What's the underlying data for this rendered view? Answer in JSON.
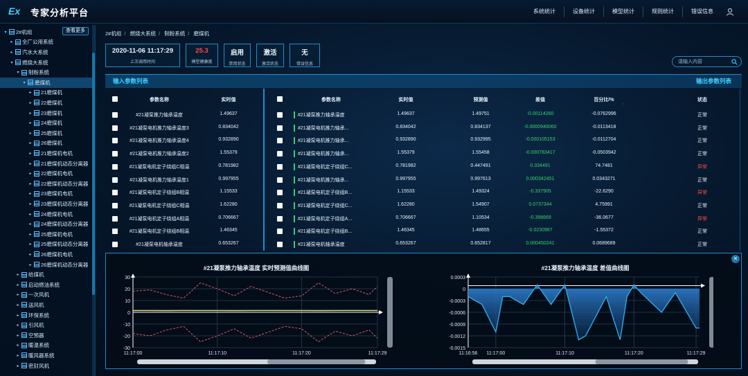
{
  "header": {
    "logo": "Ex",
    "title": "专家分析平台",
    "nav": [
      "系统统计",
      "设备统计",
      "模型统计",
      "规则统计",
      "错误信息"
    ],
    "colors": {
      "accent": "#3fd0ff",
      "panel_border": "#1c8fcf",
      "ok_green": "#35d36d",
      "alarm_red": "#ff4b4b"
    }
  },
  "sidebar": {
    "more_label": "查看更多",
    "tree": [
      {
        "label": "2#机组",
        "caret": "▾",
        "indent": 0
      },
      {
        "label": "全厂公用系统",
        "caret": "▸",
        "indent": 1
      },
      {
        "label": "汽水大系统",
        "caret": "▸",
        "indent": 1
      },
      {
        "label": "燃烧大系统",
        "caret": "▾",
        "indent": 1
      },
      {
        "label": "制粉系统",
        "caret": "▾",
        "indent": 2
      },
      {
        "label": "磨煤机",
        "caret": "▾",
        "indent": 3,
        "selected": true
      },
      {
        "label": "21磨煤机",
        "caret": "▸",
        "indent": 4
      },
      {
        "label": "22磨煤机",
        "caret": "▸",
        "indent": 4
      },
      {
        "label": "23磨煤机",
        "caret": "▸",
        "indent": 4
      },
      {
        "label": "24磨煤机",
        "caret": "▸",
        "indent": 4
      },
      {
        "label": "25磨煤机",
        "caret": "▸",
        "indent": 4
      },
      {
        "label": "26磨煤机",
        "caret": "▸",
        "indent": 4
      },
      {
        "label": "21磨煤机电机",
        "caret": "▸",
        "indent": 4
      },
      {
        "label": "21磨煤机动态分离器",
        "caret": "▸",
        "indent": 4
      },
      {
        "label": "22磨煤机电机",
        "caret": "▸",
        "indent": 4
      },
      {
        "label": "22磨煤机动态分离器",
        "caret": "▸",
        "indent": 4
      },
      {
        "label": "23磨煤机电机",
        "caret": "▸",
        "indent": 4
      },
      {
        "label": "23磨煤机动态分离器",
        "caret": "▸",
        "indent": 4
      },
      {
        "label": "24磨煤机电机",
        "caret": "▸",
        "indent": 4
      },
      {
        "label": "24磨煤机动态分离器",
        "caret": "▸",
        "indent": 4
      },
      {
        "label": "25磨煤机电机",
        "caret": "▸",
        "indent": 4
      },
      {
        "label": "25磨煤机动态分离器",
        "caret": "▸",
        "indent": 4
      },
      {
        "label": "26磨煤机电机",
        "caret": "▸",
        "indent": 4
      },
      {
        "label": "26磨煤机动态分离器",
        "caret": "▸",
        "indent": 4
      },
      {
        "label": "给煤机",
        "caret": "▸",
        "indent": 2
      },
      {
        "label": "启动燃油系统",
        "caret": "▸",
        "indent": 2
      },
      {
        "label": "一次风机",
        "caret": "▸",
        "indent": 2
      },
      {
        "label": "送风机",
        "caret": "▸",
        "indent": 2
      },
      {
        "label": "环保系统",
        "caret": "▸",
        "indent": 2
      },
      {
        "label": "引风机",
        "caret": "▸",
        "indent": 2
      },
      {
        "label": "空预器",
        "caret": "▸",
        "indent": 2
      },
      {
        "label": "暖温系统",
        "caret": "▸",
        "indent": 2
      },
      {
        "label": "暖风器系统",
        "caret": "▸",
        "indent": 2
      },
      {
        "label": "密封风机",
        "caret": "▸",
        "indent": 2
      }
    ]
  },
  "breadcrumb": [
    "2#机组",
    "燃烧大系统",
    "制粉系统",
    "磨煤机"
  ],
  "stats": [
    {
      "value": "2020-11-06 11:17:29",
      "label": "上次调用时间"
    },
    {
      "value": "25.3",
      "label": "模型健康度",
      "red": true
    },
    {
      "value": "启用",
      "label": "禁用状态"
    },
    {
      "value": "激活",
      "label": "激活状态"
    },
    {
      "value": "无",
      "label": "错误信息"
    }
  ],
  "search": {
    "placeholder": "请输入内容"
  },
  "input_panel": {
    "title": "输入参数列表",
    "headers": [
      "参数名称",
      "实时值"
    ],
    "rows": [
      [
        "#21凝泵推力轴承温度",
        "1.49637"
      ],
      [
        "#21凝泵电机推力轴承温度3",
        "0.834042"
      ],
      [
        "#21凝泵电机推力轴承温度4",
        "0.932890"
      ],
      [
        "#21凝泵电机推力轴承温度2",
        "1.55379"
      ],
      [
        "#21凝泵电机定子绕组C相温",
        "0.781982"
      ],
      [
        "#21凝泵电机推力轴承温度1",
        "0.997955"
      ],
      [
        "#21凝泵电机定子绕组B相温",
        "1.15533"
      ],
      [
        "#21凝泵电机定子绕组C相温",
        "1.62280"
      ],
      [
        "#21凝泵电机定子绕组A相温",
        "0.706667"
      ],
      [
        "#21凝泵电机定子绕组B相温",
        "1.46345"
      ],
      [
        "#21凝泵电机轴承温度",
        "0.653267"
      ]
    ]
  },
  "output_panel": {
    "title": "输出参数列表",
    "headers": [
      "参数名称",
      "实时值",
      "预测值",
      "差值",
      "百分比/%",
      "状态"
    ],
    "rows": [
      [
        "#21凝泵推力轴承温度",
        "1.49637",
        "1.49751",
        "-0.00114260",
        "-0.0762996",
        "正常"
      ],
      [
        "#21凝泵电机推力轴承...",
        "0.834042",
        "0.834137",
        "-0.0000946060",
        "-0.0113418",
        "正常"
      ],
      [
        "#21凝泵电机推力轴承...",
        "0.932890",
        "0.932995",
        "-0.000105153",
        "-0.0112704",
        "正常"
      ],
      [
        "#21凝泵电机推力轴承...",
        "1.55379",
        "1.55458",
        "-0.000783417",
        "-0.0503942",
        "正常"
      ],
      [
        "#21凝泵电机定子绕组C...",
        "0.781982",
        "0.447491",
        "0.334491",
        "74.7481",
        "异常"
      ],
      [
        "#21凝泵电机推力轴承...",
        "0.997955",
        "0.997613",
        "0.000342451",
        "0.0343271",
        "正常"
      ],
      [
        "#21凝泵电机定子绕组B...",
        "1.15533",
        "1.49324",
        "-0.337905",
        "-22.6290",
        "异常"
      ],
      [
        "#21凝泵电机定子绕组C...",
        "1.62280",
        "1.54907",
        "0.0737344",
        "4.75991",
        "正常"
      ],
      [
        "#21凝泵电机定子绕组A...",
        "0.706667",
        "1.10534",
        "-0.398669",
        "-36.0677",
        "异常"
      ],
      [
        "#21凝泵电机定子绕组B...",
        "1.46345",
        "1.48655",
        "-0.0230967",
        "-1.55372",
        "正常"
      ],
      [
        "#21凝泵电机轴承温度",
        "0.653267",
        "0.652817",
        "0.000450241",
        "0.0689689",
        "正常"
      ]
    ]
  },
  "chart_data": [
    {
      "type": "line",
      "title": "#21凝泵推力轴承温度 实时预测值曲线图",
      "xlabel": "",
      "ylabel": "",
      "ylim": [
        -30,
        30
      ],
      "yticks": [
        30,
        20,
        10,
        0,
        -10,
        -20,
        -30
      ],
      "xticks": [
        "11:17:00",
        "11:17:10",
        "11:17:20",
        "11:17:29"
      ],
      "x": [
        0,
        2,
        4,
        6,
        8,
        10,
        12,
        14,
        16,
        18,
        20,
        22,
        24,
        26,
        28,
        29
      ],
      "series": [
        {
          "values": [
            18,
            19,
            15,
            12,
            25,
            20,
            14,
            22,
            17,
            12,
            14,
            25,
            16,
            20,
            15,
            22
          ],
          "color": "#e05a5a",
          "dashed": true
        },
        {
          "values": [
            -18,
            -20,
            -15,
            -12,
            -25,
            -20,
            -14,
            -22,
            -17,
            -12,
            -14,
            -25,
            -16,
            -20,
            -15,
            -22
          ],
          "color": "#e05a5a",
          "dashed": true
        },
        {
          "values": [
            1.5,
            1.5,
            1.4,
            1.6,
            1.5,
            1.5,
            1.4,
            1.5,
            1.6,
            1.5,
            1.5,
            1.4,
            1.5,
            1.6,
            1.5,
            1.5
          ],
          "color": "#2fd0ff"
        },
        {
          "values": [
            1.5,
            1.5,
            1.5,
            1.5,
            1.5,
            1.5,
            1.5,
            1.5,
            1.5,
            1.5,
            1.5,
            1.5,
            1.5,
            1.5,
            1.5,
            1.5
          ],
          "color": "#e9d24a"
        }
      ]
    },
    {
      "type": "area",
      "title": "#21凝泵推力轴承温度 差值曲线图",
      "xlabel": "",
      "ylabel": "",
      "ylim": [
        -0.0015,
        0.0003
      ],
      "yticks": [
        0.0003,
        0,
        -0.0003,
        -0.0006,
        -0.0009,
        -0.0012,
        -0.0015
      ],
      "ytick_labels": [
        "0.0003",
        "0",
        "-0.0003",
        "-0.0006",
        "-0.0009",
        "-0.0012",
        "-0.0015"
      ],
      "xticks": [
        "11:16:56",
        "11:17:00",
        "11:17:10",
        "11:17:20",
        "11:17:29"
      ],
      "x": [
        -4,
        -2,
        0,
        1,
        2,
        4,
        6,
        8,
        10,
        12,
        13,
        16,
        18,
        19,
        20,
        21,
        24,
        26,
        29,
        29.5
      ],
      "series": [
        {
          "values": [
            -0.0002,
            -0.0004,
            -0.0011,
            -0.0002,
            -0.0002,
            -0.0004,
            0.0001,
            -0.0004,
            0.0001,
            -0.0013,
            -0.0012,
            -0.0002,
            -0.0013,
            -0.0002,
            0.0001,
            -0.0001,
            -0.0006,
            -0.0001,
            -0.001,
            -0.001
          ],
          "color": "#2fa9e6"
        }
      ]
    }
  ]
}
